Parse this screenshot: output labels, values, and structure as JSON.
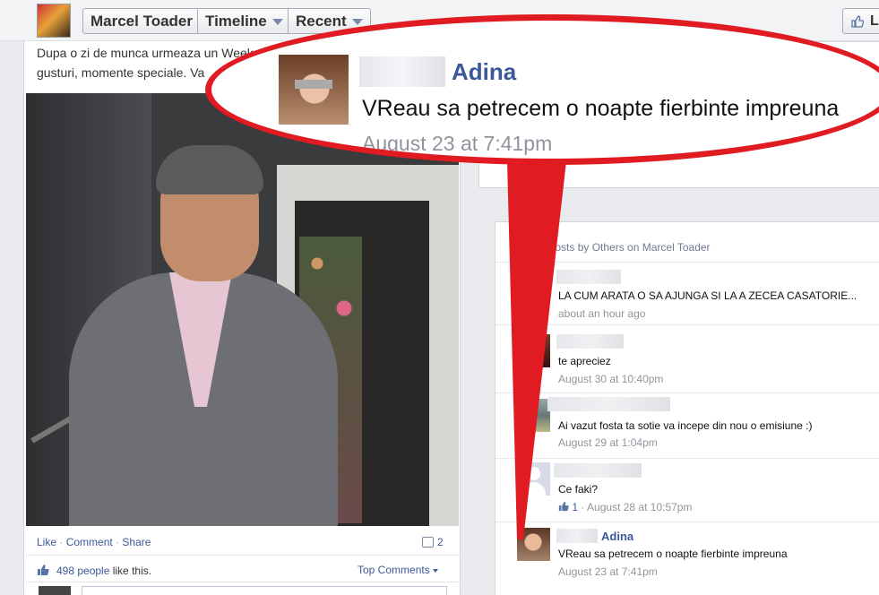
{
  "header": {
    "profile_name": "Marcel Toader",
    "timeline_label": "Timeline",
    "recent_label": "Recent",
    "like_label": "Li"
  },
  "post": {
    "text_line1": "Dupa o zi de munca urmeaza un Week",
    "text_line2": "gusturi, momente speciale. Va",
    "actions": {
      "like": "Like",
      "comment": "Comment",
      "share": "Share"
    },
    "comment_count": "2",
    "likes_count": "498 people",
    "likes_suffix": " like this.",
    "top_comments": "Top Comments"
  },
  "callout": {
    "name": "Adina",
    "message": "VReau sa petrecem o noapte fierbinte impreuna",
    "time": "August 23 at 7:41pm"
  },
  "recent_posts": {
    "title": "Recent Posts by Others on Marcel Toader",
    "items": [
      {
        "message": "LA CUM ARATA O SA AJUNGA SI LA A ZECEA CASATORIE...",
        "time": "about an hour ago"
      },
      {
        "message": "te apreciez",
        "time": "August 30 at 10:40pm"
      },
      {
        "message": "Ai vazut fosta ta sotie va incepe din nou o emisiune :)",
        "time": "August 29 at 1:04pm"
      },
      {
        "message": "Ce faki?",
        "like_count": "1",
        "time": "August 28 at 10:57pm"
      },
      {
        "name": "Adina",
        "message": "VReau sa petrecem o noapte fierbinte impreuna",
        "time": "August 23 at 7:41pm"
      }
    ]
  },
  "colors": {
    "accent": "#3b5998",
    "callout": "#e01b22"
  }
}
